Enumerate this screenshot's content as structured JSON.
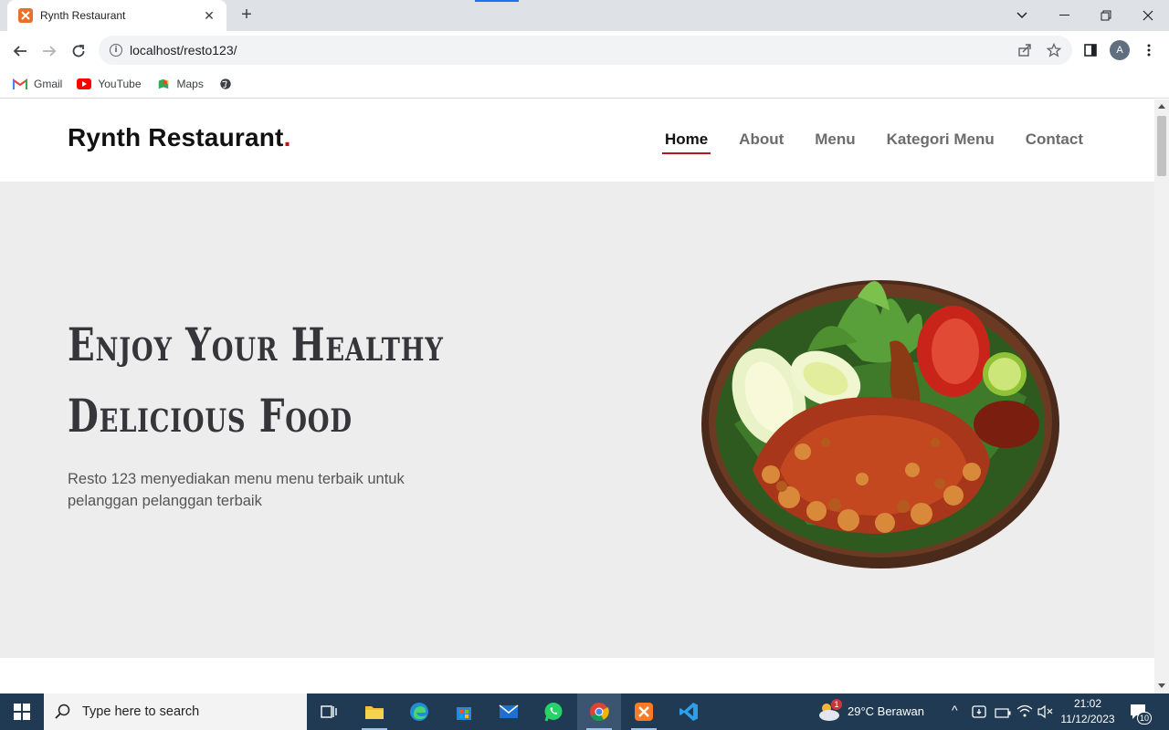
{
  "browser": {
    "tab_title": "Rynth Restaurant",
    "url": "localhost/resto123/",
    "profile_initial": "A",
    "bookmarks": [
      {
        "label": "Gmail",
        "icon": "gmail-icon"
      },
      {
        "label": "YouTube",
        "icon": "youtube-icon"
      },
      {
        "label": "Maps",
        "icon": "maps-icon"
      },
      {
        "label": "",
        "icon": "globe-icon"
      }
    ]
  },
  "site": {
    "brand": "Rynth Restaurant",
    "brand_dot": ".",
    "nav": [
      {
        "label": "Home",
        "active": true
      },
      {
        "label": "About",
        "active": false
      },
      {
        "label": "Menu",
        "active": false
      },
      {
        "label": "Kategori Menu",
        "active": false
      },
      {
        "label": "Contact",
        "active": false
      }
    ],
    "hero": {
      "title_line1": "Enjoy Your Healthy",
      "title_line2": "Delicious Food",
      "subtitle": "Resto 123 menyediakan menu menu terbaik untuk pelanggan pelanggan terbaik",
      "image": "fried-chicken-plate"
    }
  },
  "taskbar": {
    "search_placeholder": "Type here to search",
    "weather_badge": "1",
    "weather": "29°C  Berawan",
    "time": "21:02",
    "date": "11/12/2023",
    "notification_count": "10"
  },
  "colors": {
    "accent": "#b3161b",
    "hero_bg": "#eeeded",
    "taskbar": "#1f3a52"
  }
}
